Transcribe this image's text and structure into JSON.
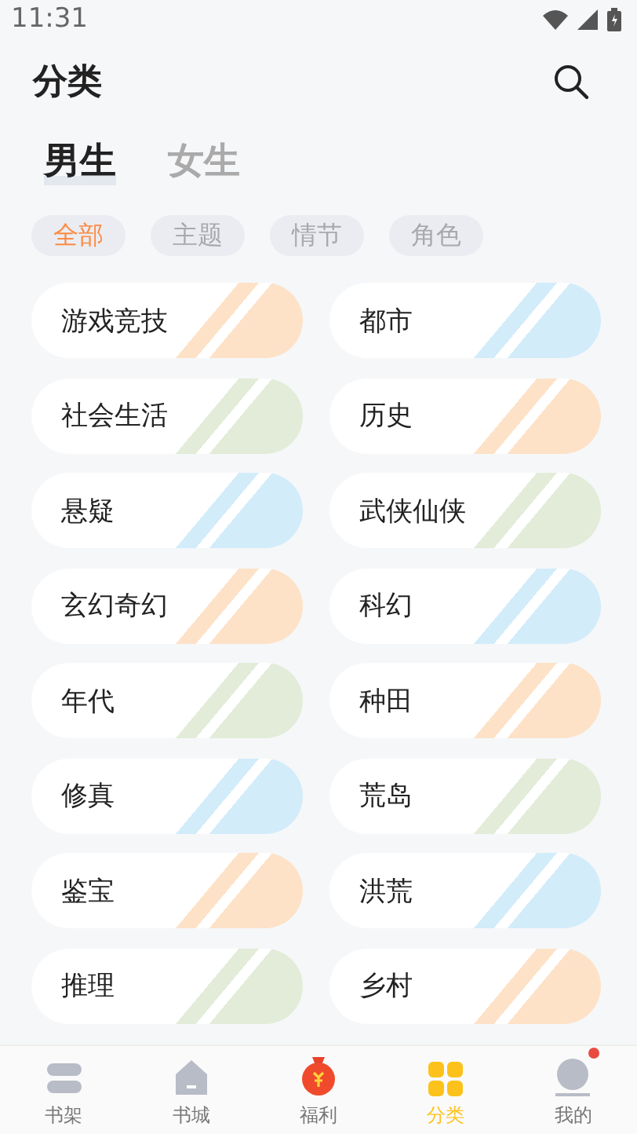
{
  "status_bar": {
    "time": "11:31"
  },
  "header": {
    "title": "分类"
  },
  "gender_tabs": [
    {
      "label": "男生",
      "selected": true
    },
    {
      "label": "女生",
      "selected": false
    }
  ],
  "filter_chips": [
    {
      "label": "全部",
      "selected": true
    },
    {
      "label": "主题",
      "selected": false
    },
    {
      "label": "情节",
      "selected": false
    },
    {
      "label": "角色",
      "selected": false
    }
  ],
  "categories": [
    {
      "label": "游戏竞技",
      "color": "#fde2c8"
    },
    {
      "label": "都市",
      "color": "#d2ecfa"
    },
    {
      "label": "社会生活",
      "color": "#e2ecd8"
    },
    {
      "label": "历史",
      "color": "#fde2c8"
    },
    {
      "label": "悬疑",
      "color": "#d2ecfa"
    },
    {
      "label": "武侠仙侠",
      "color": "#e2ecd8"
    },
    {
      "label": "玄幻奇幻",
      "color": "#fde2c8"
    },
    {
      "label": "科幻",
      "color": "#d2ecfa"
    },
    {
      "label": "年代",
      "color": "#e2ecd8"
    },
    {
      "label": "种田",
      "color": "#fde2c8"
    },
    {
      "label": "修真",
      "color": "#d2ecfa"
    },
    {
      "label": "荒岛",
      "color": "#e2ecd8"
    },
    {
      "label": "鉴宝",
      "color": "#fde2c8"
    },
    {
      "label": "洪荒",
      "color": "#d2ecfa"
    },
    {
      "label": "推理",
      "color": "#e2ecd8"
    },
    {
      "label": "乡村",
      "color": "#fde2c8"
    }
  ],
  "bottom_nav": [
    {
      "label": "书架",
      "kind": "shelf",
      "selected": false,
      "badge": false
    },
    {
      "label": "书城",
      "kind": "store",
      "selected": false,
      "badge": false
    },
    {
      "label": "福利",
      "kind": "bonus",
      "selected": false,
      "badge": false
    },
    {
      "label": "分类",
      "kind": "category",
      "selected": true,
      "badge": false
    },
    {
      "label": "我的",
      "kind": "profile",
      "selected": false,
      "badge": true
    }
  ]
}
